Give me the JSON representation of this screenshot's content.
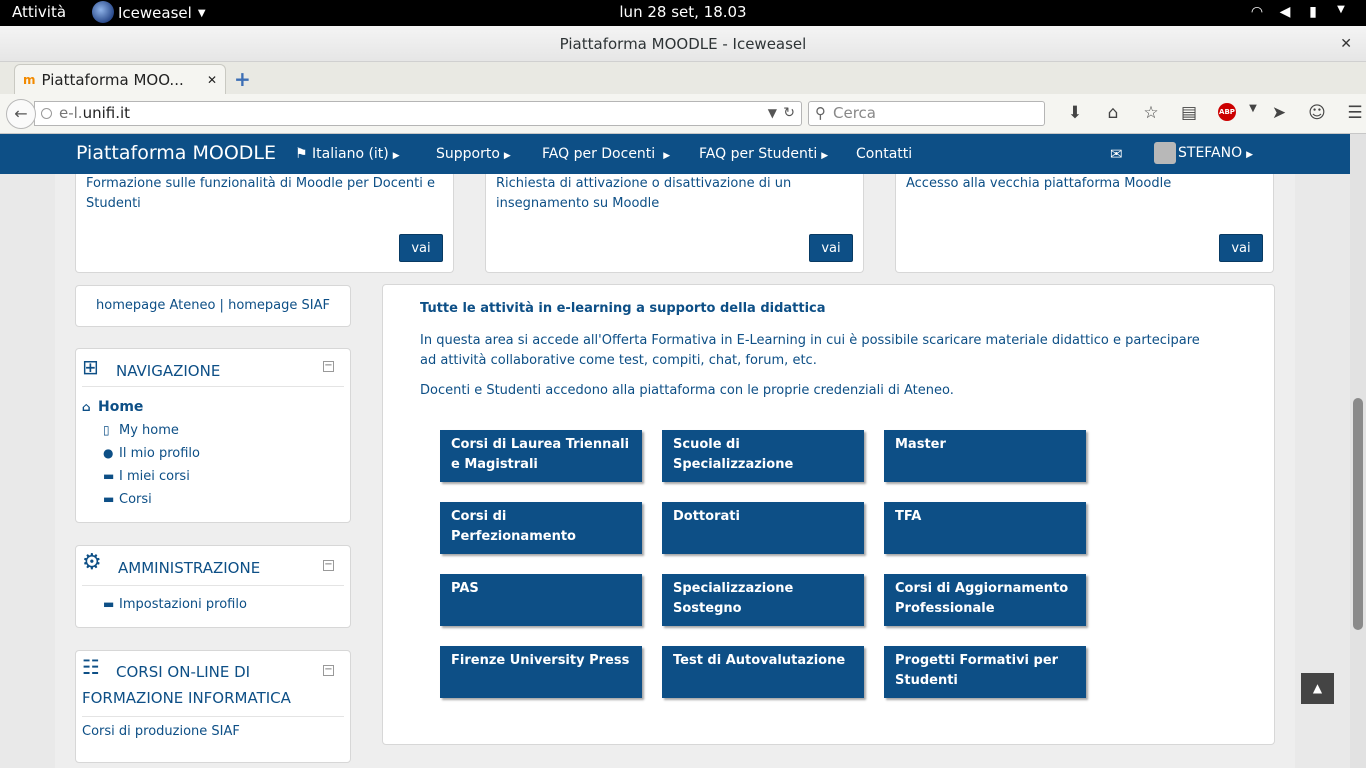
{
  "topbar": {
    "activities": "Attività",
    "app_name": "Iceweasel",
    "clock": "lun 28 set, 18.03"
  },
  "window": {
    "title": "Piattaforma MOODLE - Iceweasel"
  },
  "tabs": [
    {
      "label": "Piattaforma MOO...",
      "favicon": "moodle-icon"
    }
  ],
  "navbar": {
    "url_prefix": "e-l.",
    "url_domain": "unifi.it",
    "search_placeholder": "Cerca"
  },
  "moodle": {
    "brand": "Piattaforma MOODLE",
    "menu": [
      {
        "label": "Italiano (it)"
      },
      {
        "label": "Supporto"
      },
      {
        "label": "FAQ per Docenti"
      },
      {
        "label": "FAQ per Studenti"
      },
      {
        "label": "Contatti"
      }
    ],
    "user": "STEFANO"
  },
  "top_cards": [
    {
      "text": "Formazione sulle funzionalità di Moodle per Docenti e Studenti",
      "button": "vai"
    },
    {
      "text": "Richiesta di attivazione o disattivazione di un insegnamento su Moodle",
      "button": "vai"
    },
    {
      "text": "Accesso alla vecchia piattaforma Moodle",
      "button": "vai"
    }
  ],
  "links_block": {
    "link1": "homepage Ateneo",
    "sep": "|",
    "link2": "homepage SIAF"
  },
  "navigation": {
    "title": "NAVIGAZIONE",
    "home": "Home",
    "items": [
      {
        "label": "My home",
        "icon": "file-icon"
      },
      {
        "label": "Il mio profilo",
        "icon": "user-icon"
      },
      {
        "label": "I miei corsi",
        "icon": "folder-icon"
      },
      {
        "label": "Corsi",
        "icon": "folder-icon"
      }
    ]
  },
  "administration": {
    "title": "AMMINISTRAZIONE",
    "items": [
      {
        "label": "Impostazioni profilo",
        "icon": "folder-icon"
      }
    ]
  },
  "courses_block": {
    "title_line1": "CORSI ON-LINE DI",
    "title_line2": "FORMAZIONE INFORMATICA",
    "items": [
      {
        "label": "Corsi di produzione SIAF"
      }
    ]
  },
  "main": {
    "title": "Tutte le attività in e-learning a supporto della didattica",
    "paragraph1": "In questa area si accede all'Offerta Formativa in E-Learning in cui è possibile scaricare materiale didattico e partecipare ad attività collaborative come test, compiti, chat, forum, etc.",
    "paragraph2": "Docenti e Studenti accedono alla piattaforma con le proprie credenziali di Ateneo.",
    "tiles": [
      "Corsi di Laurea Triennali e Magistrali",
      "Scuole di Specializzazione",
      "Master",
      "Corsi di Perfezionamento",
      "Dottorati",
      "TFA",
      "PAS",
      "Specializzazione Sostegno",
      "Corsi di Aggiornamento Professionale",
      "Firenze University Press",
      "Test di Autovalutazione",
      "Progetti Formativi per Studenti"
    ]
  },
  "colors": {
    "moodle_blue": "#0d4f86",
    "page_bg": "#eeeeee"
  }
}
